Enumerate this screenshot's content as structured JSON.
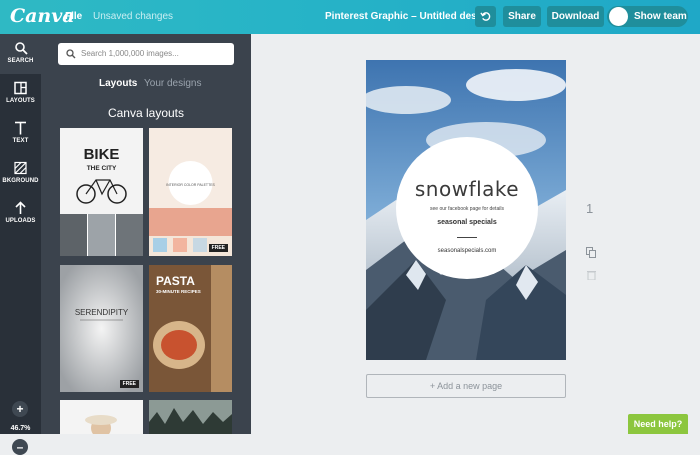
{
  "topbar": {
    "logo": "Canva",
    "file_menu": "File",
    "save_status": "Unsaved changes",
    "document_title": "Pinterest Graphic – Untitled design",
    "share_label": "Share",
    "download_label": "Download",
    "show_team_label": "Show team"
  },
  "rail": {
    "items": [
      {
        "label": "SEARCH",
        "icon": "search-icon"
      },
      {
        "label": "LAYOUTS",
        "icon": "layouts-icon"
      },
      {
        "label": "TEXT",
        "icon": "text-icon"
      },
      {
        "label": "BKGROUND",
        "icon": "background-icon"
      },
      {
        "label": "UPLOADS",
        "icon": "upload-icon"
      }
    ],
    "zoom": "46.7%"
  },
  "panel": {
    "search_placeholder": "Search 1,000,000 images...",
    "tabs": [
      "Layouts",
      "Your designs"
    ],
    "section_title": "Canva layouts",
    "thumbnails": [
      {
        "title": "BIKE",
        "subtitle": "THE CITY",
        "free": false
      },
      {
        "title": "INTERIOR COLOR PALETTES",
        "free": true
      },
      {
        "title": "SERENDIPITY",
        "free": true
      },
      {
        "title": "PASTA",
        "subtitle": "30-MINUTE RECIPES",
        "free": false
      }
    ],
    "free_badge": "FREE"
  },
  "design": {
    "title": "snowflake",
    "subtitle": "see our facebook page for details",
    "tagline": "seasonal specials",
    "url": "seasonalspecials.com"
  },
  "canvas": {
    "add_page_label": "+ Add a new page",
    "page_number": "1"
  },
  "help_label": "Need help?"
}
